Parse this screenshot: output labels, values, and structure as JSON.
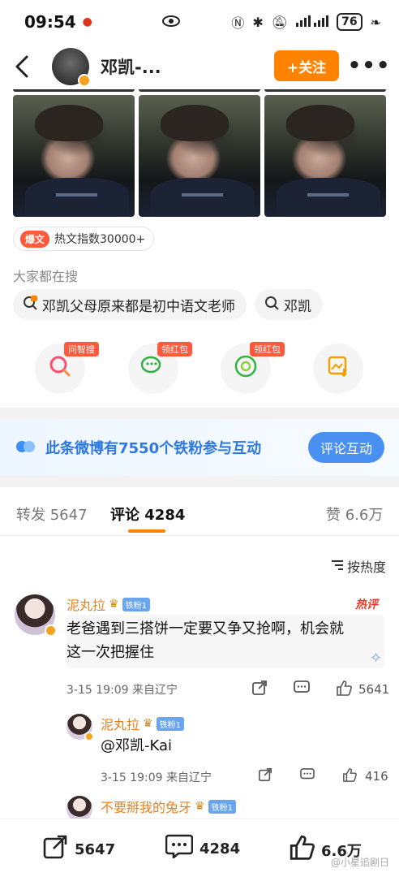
{
  "status_bar": {
    "time": "09:54",
    "battery": "76"
  },
  "nav": {
    "back_icon": "back-arrow-icon",
    "name": "邓凯-...",
    "follow_label": "+关注",
    "more_label": "•••"
  },
  "hot_badge": {
    "tag": "爆文",
    "text": "热文指数30000+"
  },
  "search": {
    "title": "大家都在搜",
    "chips": [
      {
        "icon": "hot-search-icon",
        "label": "邓凯父母原来都是初中语文老师"
      },
      {
        "icon": "search-icon",
        "label": "邓凯"
      }
    ]
  },
  "share_row": [
    {
      "icon": "zhisou-icon",
      "badge": "问智搜"
    },
    {
      "icon": "wechat-icon",
      "badge": "领红包"
    },
    {
      "icon": "moments-icon",
      "badge": "领红包"
    },
    {
      "icon": "save-image-icon",
      "badge": ""
    }
  ],
  "fans_banner": {
    "text": "此条微博有7550个铁粉参与互动",
    "button": "评论互动"
  },
  "tabs": {
    "repost": "转发 5647",
    "comments": "评论 4284",
    "likes": "赞 6.6万"
  },
  "sort_label": "按热度",
  "comments": [
    {
      "name": "泥丸拉",
      "fan_tag": "铁粉1",
      "hot_label": "热评",
      "text_line1": "老爸遇到三搭饼一定要又争又抢啊，机会就",
      "text_line2": "这一次把握住",
      "meta": "3-15 19:09  来自辽宁",
      "likes": "5641"
    },
    {
      "name": "泥丸拉",
      "fan_tag": "铁粉1",
      "text": "@邓凯-Kai",
      "meta": "3-15 19:09  来自辽宁",
      "likes": "416"
    },
    {
      "name": "不要掰我的兔牙",
      "fan_tag": "铁粉1"
    }
  ],
  "bottom_bar": {
    "repost_count": "5647",
    "comment_count": "4284",
    "like_count": "6.6万"
  },
  "watermark": "@小星追剧日",
  "colors": {
    "accent_orange": "#ff8200",
    "banner_blue": "#2d78e2",
    "button_blue": "#4a90f2",
    "hot_red": "#e83c2a",
    "name_orange": "#e8801f"
  }
}
